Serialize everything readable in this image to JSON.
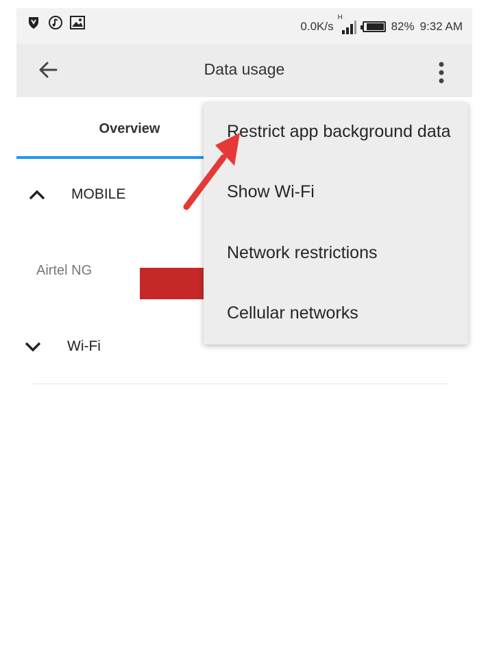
{
  "status_bar": {
    "icons_left": [
      "shield-icon",
      "music-note-icon",
      "image-icon"
    ],
    "network_speed": "0.0K/s",
    "network_type": "H",
    "battery_percent": "82%",
    "battery_level": 0.82,
    "time": "9:32 AM"
  },
  "app_bar": {
    "title": "Data usage",
    "back_icon": "arrow-left-icon",
    "more_icon": "more-vertical-icon"
  },
  "tabs": [
    {
      "label": "Overview",
      "selected": true
    }
  ],
  "sections": {
    "mobile": {
      "label": "MOBILE",
      "expanded": true
    },
    "wifi": {
      "label": "Wi-Fi",
      "expanded": false
    }
  },
  "mobile_network": {
    "name": "Airtel NG",
    "bar_color": "#c62828"
  },
  "overflow_menu": {
    "items": [
      {
        "label": "Restrict app background data"
      },
      {
        "label": "Show Wi-Fi"
      },
      {
        "label": "Network restrictions"
      },
      {
        "label": "Cellular networks"
      }
    ]
  },
  "colors": {
    "accent": "#2196f3",
    "annotation_arrow": "#e53935"
  }
}
